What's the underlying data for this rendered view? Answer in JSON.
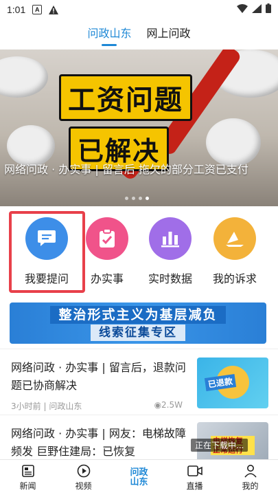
{
  "status_bar": {
    "time": "1:01",
    "icon_a": "A"
  },
  "tabs": [
    {
      "label": "问政山东",
      "active": true
    },
    {
      "label": "网上问政",
      "active": false
    }
  ],
  "banner": {
    "title_line1": "工资问题",
    "title_line2": "已解决",
    "caption": "网络问政 · 办实事 | 留言后 拖欠的部分工资已支付",
    "slide_count": 4,
    "active_slide": 4
  },
  "quick_actions": [
    {
      "label": "我要提问",
      "icon": "message-icon",
      "color": "#3d8ee8",
      "highlighted": true
    },
    {
      "label": "办实事",
      "icon": "clipboard-check-icon",
      "color": "#f0538a",
      "highlighted": false
    },
    {
      "label": "实时数据",
      "icon": "bar-chart-icon",
      "color": "#a06ee8",
      "highlighted": false
    },
    {
      "label": "我的诉求",
      "icon": "paper-plane-icon",
      "color": "#f3b23a",
      "highlighted": false
    }
  ],
  "promo": {
    "line1": "整治形式主义为基层减负",
    "line2": "线索征集专区"
  },
  "news": [
    {
      "title": "网络问政 · 办实事 | 留言后，退款问题已协商解决",
      "time": "3小时前",
      "source": "问政山东",
      "views": "2.5W",
      "thumb_text": "已退款"
    },
    {
      "title": "网络问政 · 办实事 | 网友：电梯故障频发 巨野住建局：已恢复",
      "thumb_text": "电梯恢复 正常运行",
      "overlay_text": "正在下载中..."
    }
  ],
  "bottom_nav": [
    {
      "label": "新闻",
      "icon": "news-icon"
    },
    {
      "label": "视频",
      "icon": "play-icon"
    },
    {
      "label": "问政山东",
      "icon": "wenzheng-logo",
      "active": true
    },
    {
      "label": "直播",
      "icon": "live-camera-icon"
    },
    {
      "label": "我的",
      "icon": "user-icon"
    }
  ],
  "colors": {
    "accent": "#1e88d6",
    "highlight_box": "#e8404a"
  }
}
